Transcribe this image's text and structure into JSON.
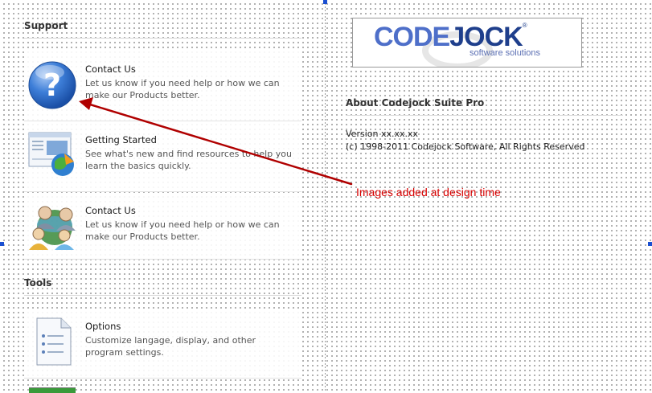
{
  "support": {
    "title": "Support",
    "cards": [
      {
        "title": "Contact Us",
        "desc": "Let us know if you need help or how we can make our Products better.",
        "icon": "help-icon"
      },
      {
        "title": "Getting Started",
        "desc": "See what's new and find resources to help you learn the basics quickly.",
        "icon": "getting-started-icon"
      },
      {
        "title": "Contact Us",
        "desc": "Let us know if you need help or how we can make our Products better.",
        "icon": "users-icon"
      }
    ]
  },
  "tools": {
    "title": "Tools",
    "cards": [
      {
        "title": "Options",
        "desc": "Customize langage, display, and other program settings.",
        "icon": "options-document-icon"
      }
    ]
  },
  "logo": {
    "brand_left": "CODE",
    "brand_right": "JOCK",
    "registered": "®",
    "tagline": "software solutions"
  },
  "about": {
    "title": "About Codejock Suite Pro",
    "version": "Version xx.xx.xx",
    "copyright": "(c) 1998-2011 Codejock Software, All Rights Reserved"
  },
  "annotation": {
    "text": "Images added at design time",
    "color": "#d80000"
  },
  "colors": {
    "accent": "#1f3f8c",
    "arrow": "#b00000"
  }
}
